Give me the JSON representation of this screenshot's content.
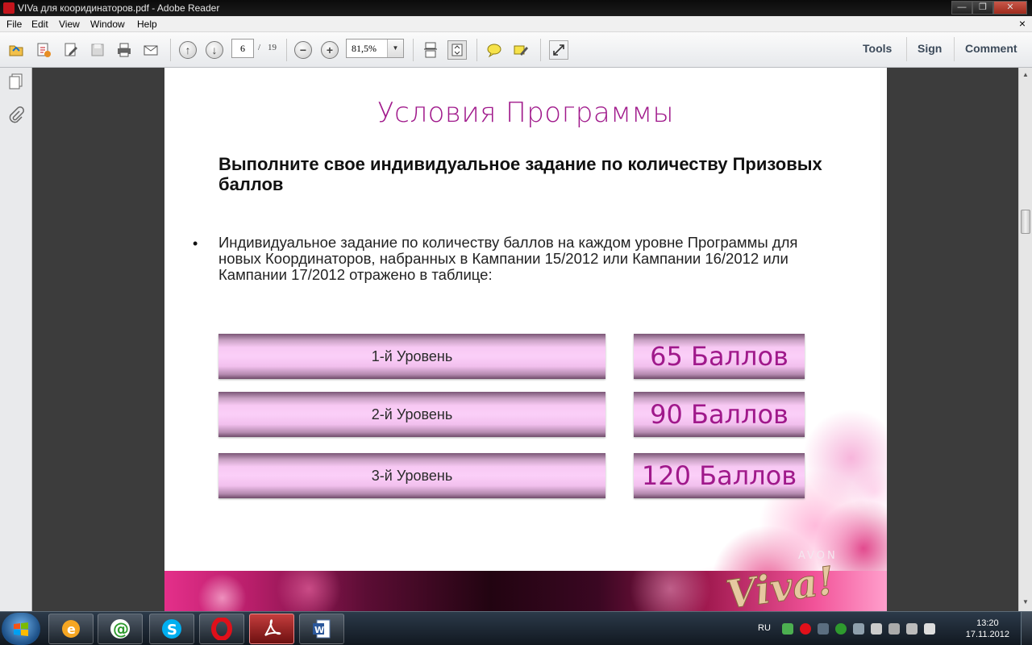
{
  "window": {
    "title": "VIVa для кооридинаторов.pdf - Adobe Reader",
    "buttons": {
      "minimize": "—",
      "maximize": "❐",
      "close": "✕"
    }
  },
  "menu": {
    "items": [
      "File",
      "Edit",
      "View",
      "Window",
      "Help"
    ],
    "close_doc": "×"
  },
  "toolbar": {
    "page_current": "6",
    "page_separator": "/",
    "page_total": "19",
    "zoom": "81,5%",
    "right_links": [
      "Tools",
      "Sign",
      "Comment"
    ]
  },
  "document": {
    "title": "Условия Программы",
    "subtitle": "Выполните свое индивидуальное задание по количеству Призовых баллов",
    "bullet_symbol": "•",
    "bullet": "Индивидуальное задание по количеству баллов на каждом уровне Программы для новых Координаторов, набранных в Кампании 15/2012 или Кампании 16/2012 или Кампании 17/2012 отражено в таблице:",
    "levels": [
      {
        "label": "1-й Уровень",
        "points": "65 Баллов"
      },
      {
        "label": "2-й Уровень",
        "points": "90 Баллов"
      },
      {
        "label": "3-й Уровень",
        "points": "120 Баллов"
      }
    ],
    "brand": "AVON",
    "logo_text": "Viva!"
  },
  "taskbar": {
    "tasks": [
      "ie-browser",
      "mail-agent",
      "skype",
      "opera",
      "adobe-reader",
      "word"
    ],
    "active_task": "adobe-reader",
    "lang": "RU",
    "time": "13:20",
    "date": "17.11.2012"
  },
  "colors": {
    "accent_magenta": "#a0198b",
    "bar_pink": "#fbcff8"
  }
}
